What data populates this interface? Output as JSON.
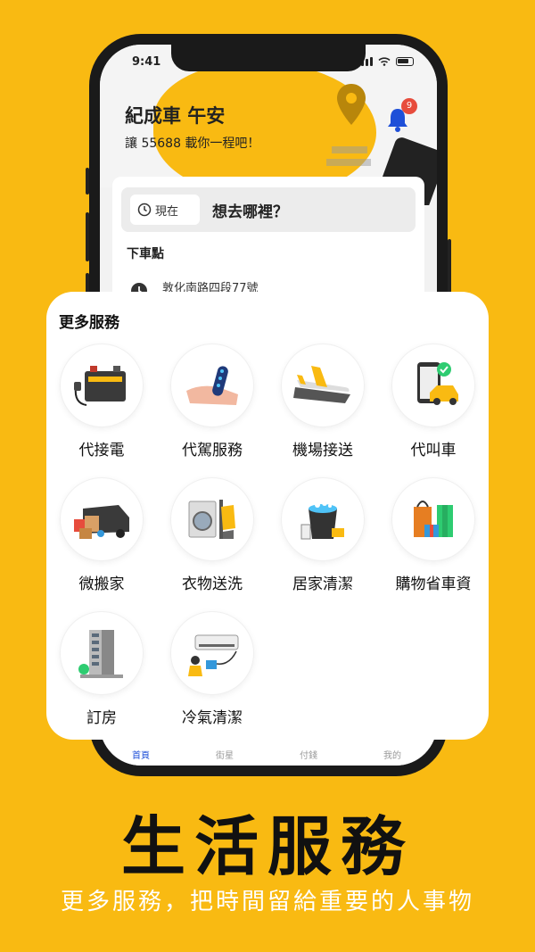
{
  "status": {
    "time": "9:41"
  },
  "header": {
    "greeting": "紀成車 午安",
    "subtitle": "讓 55688 載你一程吧！",
    "notification_count": "9"
  },
  "search": {
    "time_pill": "現在",
    "prompt": "想去哪裡？",
    "dropoff_label": "下車點",
    "dropoff_address": "敦化南路四段77號"
  },
  "tabs": [
    "首頁",
    "街星",
    "付錢",
    "我的"
  ],
  "panel": {
    "title": "更多服務",
    "services": [
      {
        "label": "代接電",
        "icon": "car-battery-icon"
      },
      {
        "label": "代駕服務",
        "icon": "car-key-hand-icon"
      },
      {
        "label": "機場接送",
        "icon": "airplane-icon"
      },
      {
        "label": "代叫車",
        "icon": "phone-taxi-icon"
      },
      {
        "label": "微搬家",
        "icon": "moving-van-icon"
      },
      {
        "label": "衣物送洗",
        "icon": "washing-machine-icon"
      },
      {
        "label": "居家清潔",
        "icon": "cleaning-bucket-icon"
      },
      {
        "label": "購物省車資",
        "icon": "shopping-bags-icon"
      },
      {
        "label": "訂房",
        "icon": "hotel-building-icon"
      },
      {
        "label": "冷氣清潔",
        "icon": "air-conditioner-icon"
      }
    ]
  },
  "promo": {
    "title": "生活服務",
    "tagline": "更多服務，把時間留給重要的人事物"
  },
  "colors": {
    "brand_yellow": "#F9BA12"
  }
}
